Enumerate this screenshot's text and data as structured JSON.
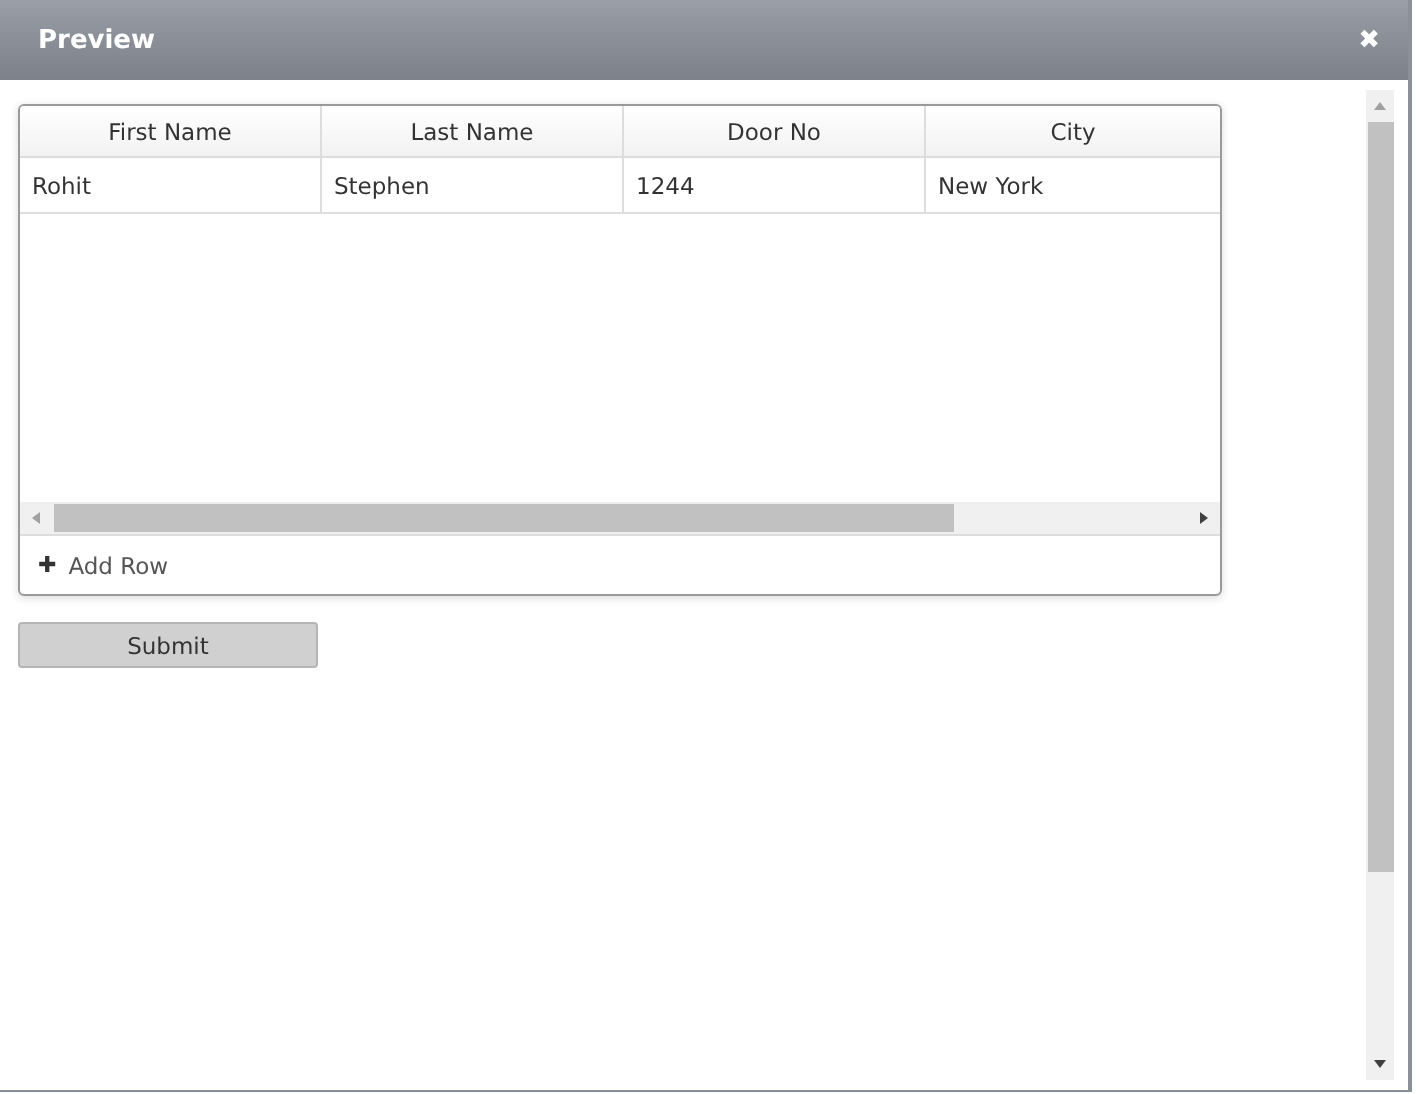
{
  "dialog": {
    "title": "Preview",
    "close_icon": "✖"
  },
  "table": {
    "columns": [
      "First Name",
      "Last Name",
      "Door No",
      "City"
    ],
    "rows": [
      [
        "Rohit",
        "Stephen",
        "1244",
        "New York"
      ]
    ]
  },
  "add_row": {
    "icon": "✚",
    "label": "Add Row"
  },
  "submit_button": "Submit"
}
